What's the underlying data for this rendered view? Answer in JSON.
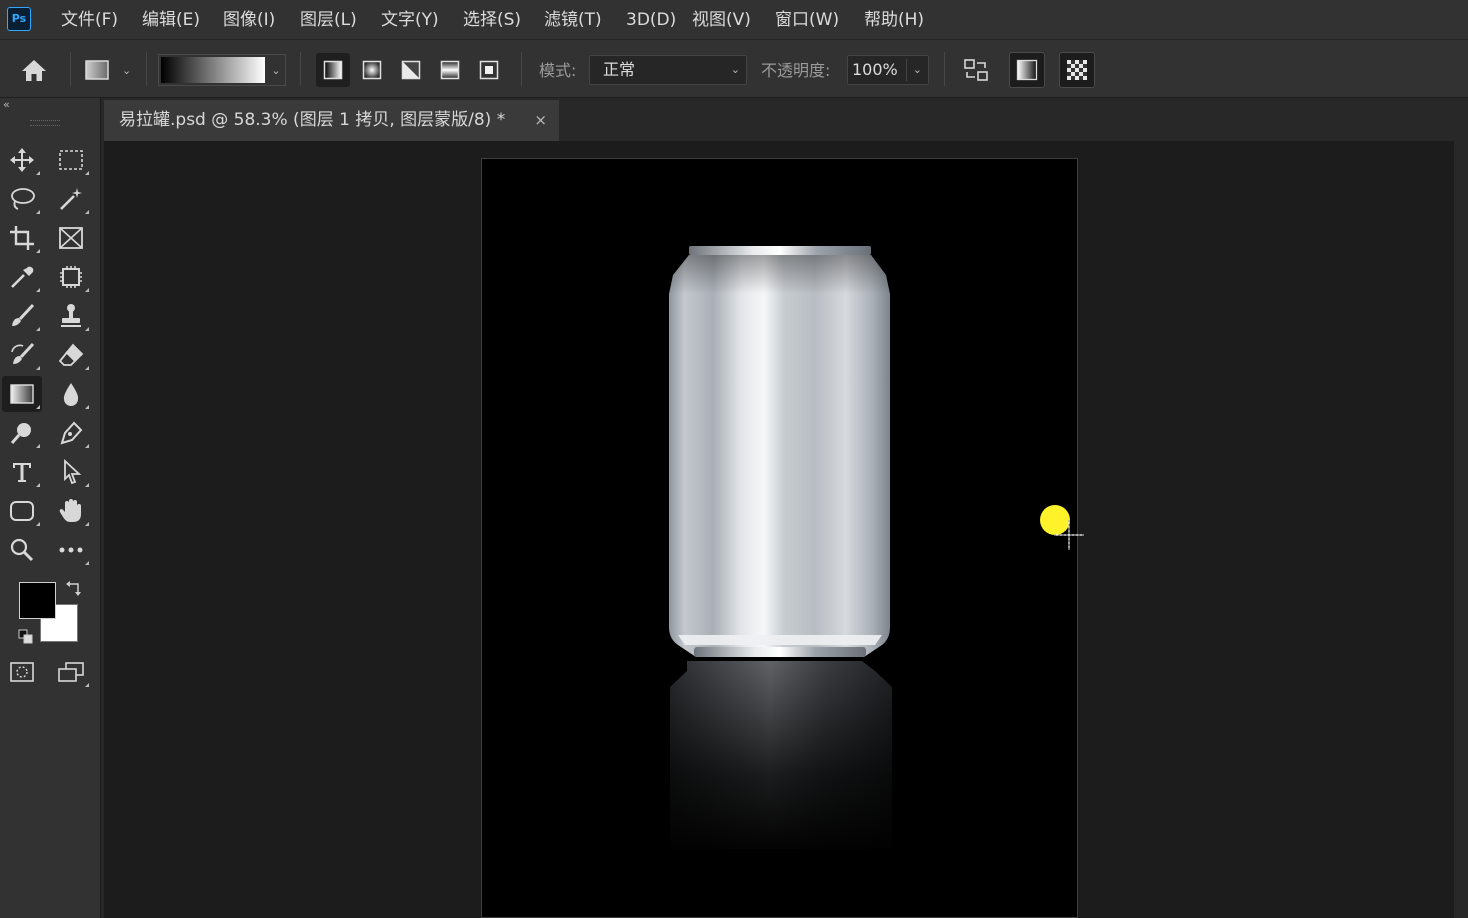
{
  "app": {
    "logo_text": "Ps",
    "accent_color": "#31a8ff"
  },
  "menu": {
    "items": [
      "文件(F)",
      "编辑(E)",
      "图像(I)",
      "图层(L)",
      "文字(Y)",
      "选择(S)",
      "滤镜(T)",
      "3D(D)",
      "视图(V)",
      "窗口(W)",
      "帮助(H)"
    ]
  },
  "options": {
    "home_icon": "home-icon",
    "gradient_preset_icon": "gradient-preset-icon",
    "gradient_modes": [
      "linear-gradient-icon",
      "radial-gradient-icon",
      "angle-gradient-icon",
      "reflected-gradient-icon",
      "diamond-gradient-icon"
    ],
    "active_gradient_mode": "linear",
    "mode_label": "模式:",
    "mode_value": "正常",
    "opacity_label": "不透明度:",
    "opacity_value": "100%",
    "reverse_icon": "reverse-icon",
    "dither_icon": "dither-icon",
    "transparency_icon": "transparency-icon"
  },
  "tools": {
    "collapse_icon": "collapse-chevrons-icon",
    "selected_tool": "gradient-tool",
    "items": [
      "move-tool",
      "marquee-tool",
      "lasso-tool",
      "magic-wand-tool",
      "crop-tool",
      "frame-tool",
      "eyedropper-tool",
      "patch-tool",
      "brush-tool",
      "stamp-tool",
      "history-brush-tool",
      "eraser-tool",
      "gradient-tool",
      "blur-tool",
      "dodge-tool",
      "pen-tool",
      "type-tool",
      "path-selection-tool",
      "shape-tool",
      "hand-tool",
      "zoom-tool",
      "more-tools",
      "quick-mask",
      "screen-mode"
    ],
    "foreground_color": "#000000",
    "background_color": "#ffffff"
  },
  "document": {
    "tab_title": "易拉罐.psd @ 58.3% (图层 1 拷贝, 图层蒙版/8) *",
    "tab_close": "×",
    "canvas_background": "#000000",
    "content": "aluminum-can-icon"
  },
  "cursor": {
    "highlight_color": "#fff22a"
  }
}
